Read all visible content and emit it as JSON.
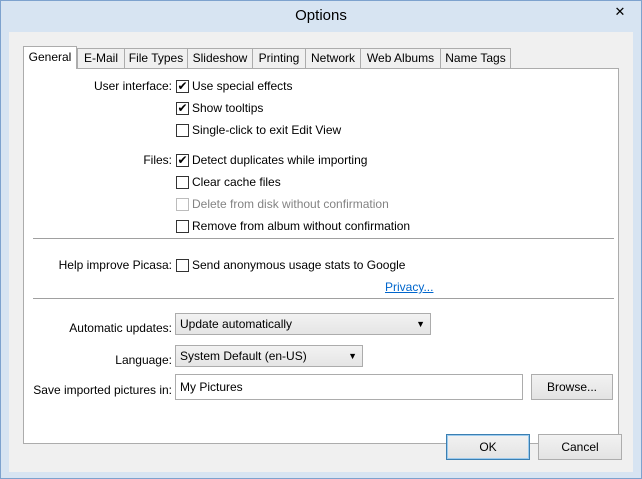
{
  "window": {
    "title": "Options",
    "close_glyph": "✕"
  },
  "tabs": [
    {
      "label": "General",
      "active": true
    },
    {
      "label": "E-Mail"
    },
    {
      "label": "File Types"
    },
    {
      "label": "Slideshow"
    },
    {
      "label": "Printing"
    },
    {
      "label": "Network"
    },
    {
      "label": "Web Albums"
    },
    {
      "label": "Name Tags"
    }
  ],
  "user_interface": {
    "label": "User interface:",
    "options": [
      {
        "label": "Use special effects",
        "checked": true
      },
      {
        "label": "Show tooltips",
        "checked": true
      },
      {
        "label": "Single-click to exit Edit View",
        "checked": false
      }
    ]
  },
  "files": {
    "label": "Files:",
    "options": [
      {
        "label": "Detect duplicates while importing",
        "checked": true
      },
      {
        "label": "Clear cache files",
        "checked": false
      },
      {
        "label": "Delete from disk without confirmation",
        "checked": false,
        "disabled": true
      },
      {
        "label": "Remove from album without confirmation",
        "checked": false
      }
    ]
  },
  "help_improve": {
    "label": "Help improve Picasa:",
    "option": {
      "label": "Send anonymous usage stats to Google",
      "checked": false
    },
    "privacy_link": "Privacy..."
  },
  "updates": {
    "label": "Automatic updates:",
    "value": "Update automatically"
  },
  "language": {
    "label": "Language:",
    "value": "System Default (en-US)"
  },
  "save_location": {
    "label": "Save imported pictures in:",
    "value": "My Pictures",
    "browse_label": "Browse..."
  },
  "buttons": {
    "ok": "OK",
    "cancel": "Cancel"
  },
  "check_glyph": "✔",
  "dropdown_glyph": "▼"
}
